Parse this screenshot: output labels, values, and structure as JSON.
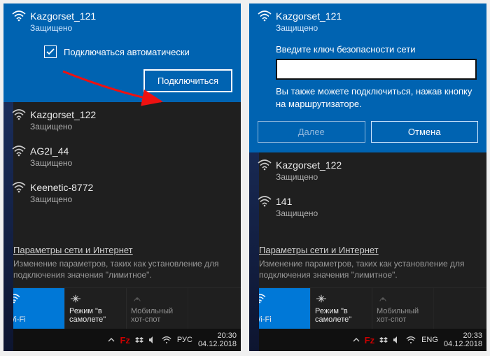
{
  "left": {
    "selected_net": {
      "name": "Kazgorset_121",
      "status": "Защищено"
    },
    "autoconnect_label": "Подключаться автоматически",
    "connect_label": "Подключиться",
    "networks": [
      {
        "name": "Kazgorset_122",
        "status": "Защищено"
      },
      {
        "name": "AG2I_44",
        "status": "Защищено"
      },
      {
        "name": "Keenetic-8772",
        "status": "Защищено"
      }
    ],
    "settings_link": "Параметры сети и Интернет",
    "settings_hint": "Изменение параметров, таких как установление для подключения значения \"лимитное\".",
    "tiles": {
      "wifi": "Wi-Fi",
      "airplane": "Режим \"в самолете\"",
      "hotspot": "Мобильный хот-спот"
    },
    "taskbar": {
      "lang": "РУС",
      "time": "20:30",
      "date": "04.12.2018"
    }
  },
  "right": {
    "selected_net": {
      "name": "Kazgorset_121",
      "status": "Защищено"
    },
    "pw_label": "Введите ключ безопасности сети",
    "pw_value": "",
    "pw_hint": "Вы также можете подключиться, нажав кнопку на маршрутизаторе.",
    "next_label": "Далее",
    "cancel_label": "Отмена",
    "networks": [
      {
        "name": "Kazgorset_122",
        "status": "Защищено"
      },
      {
        "name": "141",
        "status": "Защищено"
      }
    ],
    "settings_link": "Параметры сети и Интернет",
    "settings_hint": "Изменение параметров, таких как установление для подключения значения \"лимитное\".",
    "tiles": {
      "wifi": "Wi-Fi",
      "airplane": "Режим \"в самолете\"",
      "hotspot": "Мобильный хот-спот"
    },
    "taskbar": {
      "lang": "ENG",
      "time": "20:33",
      "date": "04.12.2018"
    }
  }
}
